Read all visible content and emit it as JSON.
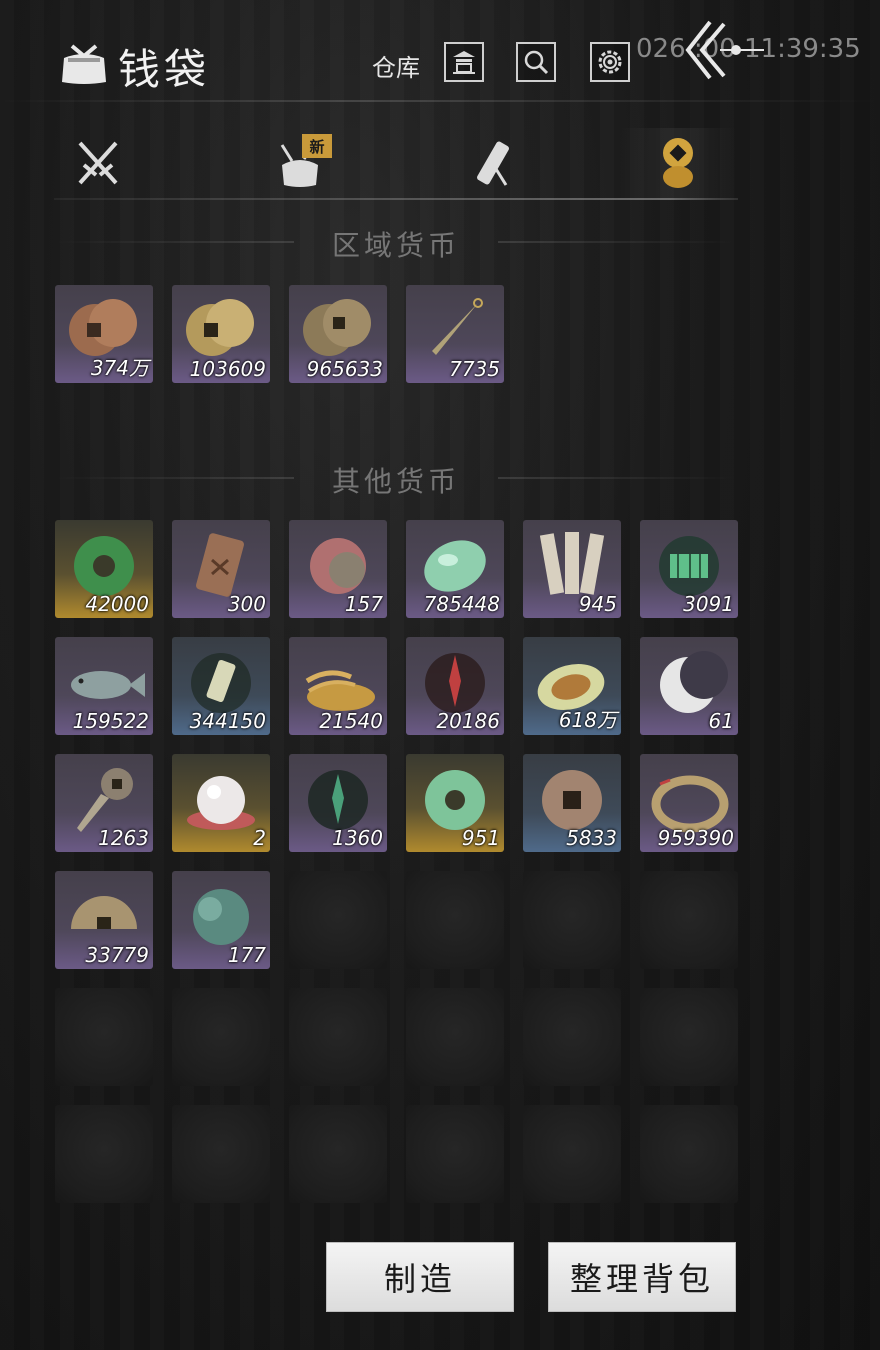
{
  "header": {
    "title": "钱袋",
    "warehouse_label": "仓库",
    "clock": "026  :00 11:39:35"
  },
  "tabs": [
    {
      "icon": "crossed-swords-icon"
    },
    {
      "icon": "bundle-icon",
      "badge": "新"
    },
    {
      "icon": "scroll-icon"
    },
    {
      "icon": "coin-stack-icon",
      "active": true
    }
  ],
  "regional": {
    "title": "区域货币",
    "items": [
      {
        "icon": "copper-coins-icon",
        "qty": "374万",
        "rarity": "purple"
      },
      {
        "icon": "gold-coins-icon",
        "qty": "103609",
        "rarity": "purple"
      },
      {
        "icon": "bronze-coins-icon",
        "qty": "965633",
        "rarity": "purple"
      },
      {
        "icon": "dagger-icon",
        "qty": "7735",
        "rarity": "purple"
      }
    ]
  },
  "other": {
    "title": "其他货币",
    "items": [
      {
        "icon": "jade-disc-icon",
        "qty": "42000",
        "rarity": "gold"
      },
      {
        "icon": "bronze-tablet-icon",
        "qty": "300",
        "rarity": "purple"
      },
      {
        "icon": "rose-stone-icon",
        "qty": "157",
        "rarity": "purple"
      },
      {
        "icon": "jade-pebble-icon",
        "qty": "785448",
        "rarity": "purple"
      },
      {
        "icon": "bamboo-slips-icon",
        "qty": "945",
        "rarity": "purple"
      },
      {
        "icon": "map-glow-icon",
        "qty": "3091",
        "rarity": "purple"
      },
      {
        "icon": "fish-icon",
        "qty": "159522",
        "rarity": "purple"
      },
      {
        "icon": "token-card-icon",
        "qty": "344150",
        "rarity": "blue"
      },
      {
        "icon": "grain-pile-icon",
        "qty": "21540",
        "rarity": "purple"
      },
      {
        "icon": "red-rune-icon",
        "qty": "20186",
        "rarity": "purple"
      },
      {
        "icon": "melon-icon",
        "qty": "618万",
        "rarity": "blue"
      },
      {
        "icon": "crescent-moon-icon",
        "qty": "61",
        "rarity": "purple"
      },
      {
        "icon": "key-coin-icon",
        "qty": "1263",
        "rarity": "purple"
      },
      {
        "icon": "pearl-icon",
        "qty": "2",
        "rarity": "gold"
      },
      {
        "icon": "green-rune-icon",
        "qty": "1360",
        "rarity": "purple"
      },
      {
        "icon": "jade-ring-icon",
        "qty": "951",
        "rarity": "gold"
      },
      {
        "icon": "square-hole-coin-icon",
        "qty": "5833",
        "rarity": "blue"
      },
      {
        "icon": "coin-string-icon",
        "qty": "959390",
        "rarity": "purple"
      },
      {
        "icon": "half-coin-icon",
        "qty": "33779",
        "rarity": "purple"
      },
      {
        "icon": "teal-stone-icon",
        "qty": "177",
        "rarity": "purple"
      }
    ]
  },
  "buttons": {
    "craft": "制造",
    "sort": "整理背包"
  }
}
